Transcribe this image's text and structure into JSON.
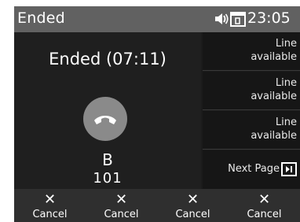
{
  "status_bar": {
    "title": "Ended",
    "time": "23:05",
    "icons": [
      "speaker-volume-icon",
      "handset-box-icon"
    ]
  },
  "call": {
    "state": "Ended",
    "duration": "(07:11)",
    "name": "B",
    "number": "101",
    "icon": "end-call-handset-icon",
    "icon_color": "#8a8a8a"
  },
  "line_keys": [
    {
      "line1": "Line",
      "line2": "available"
    },
    {
      "line1": "Line",
      "line2": "available"
    },
    {
      "line1": "Line",
      "line2": "available"
    }
  ],
  "next_page": {
    "label": "Next Page",
    "icon": "page-forward-icon"
  },
  "softkeys": [
    {
      "symbol": "✕",
      "label": "Cancel"
    },
    {
      "symbol": "✕",
      "label": "Cancel"
    },
    {
      "symbol": "✕",
      "label": "Cancel"
    },
    {
      "symbol": "✕",
      "label": "Cancel"
    }
  ],
  "colors": {
    "status_bar": "#616161",
    "background": "#1b1b1b",
    "softkey_bar": "#2f2f2f"
  }
}
